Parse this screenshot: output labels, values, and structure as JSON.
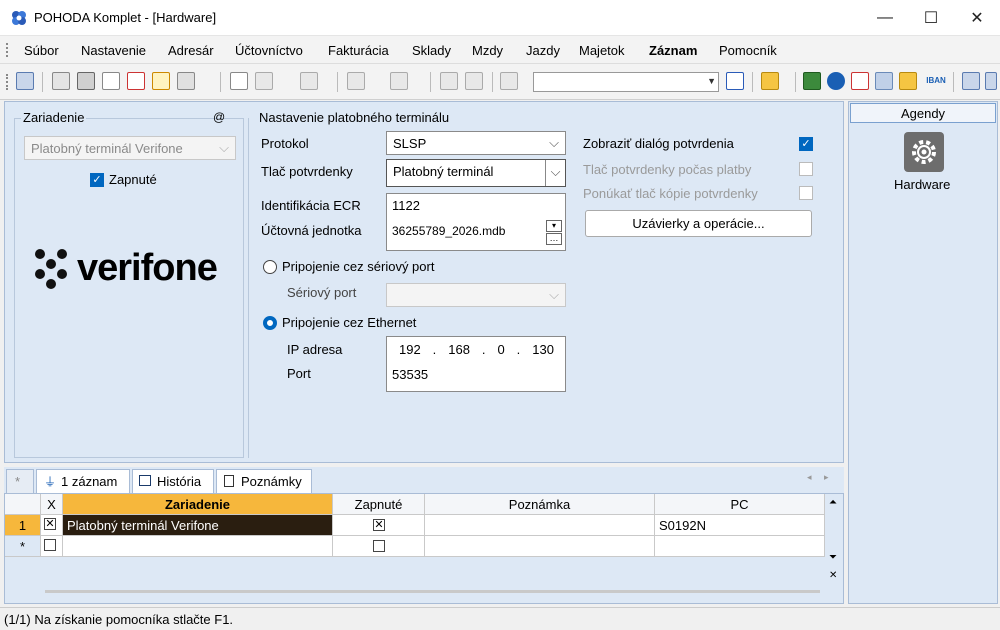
{
  "window": {
    "title": "POHODA Komplet - [Hardware]",
    "minimize": "—",
    "maximize": "☐",
    "close": "✕"
  },
  "menu": [
    {
      "label": "Súbor"
    },
    {
      "label": "Nastavenie"
    },
    {
      "label": "Adresár"
    },
    {
      "label": "Účtovníctvo"
    },
    {
      "label": "Fakturácia"
    },
    {
      "label": "Sklady"
    },
    {
      "label": "Mzdy"
    },
    {
      "label": "Jazdy"
    },
    {
      "label": "Majetok"
    },
    {
      "label": "Záznam"
    },
    {
      "label": "Pomocník"
    }
  ],
  "toolbar": {
    "combo_value": "",
    "iban_label": "IBAN"
  },
  "device_group": {
    "title": "Zariadenie",
    "at_symbol": "@",
    "device_select": "Platobný terminál Verifone",
    "enabled_label": "Zapnuté",
    "enabled": true,
    "logo_text": "verifone"
  },
  "terminal_group": {
    "title": "Nastavenie platobného terminálu",
    "protocol_label": "Protokol",
    "protocol_value": "SLSP",
    "print_label": "Tlač potvrdenky",
    "print_value": "Platobný terminál",
    "ecr_label": "Identifikácia ECR",
    "ecr_value": "1122",
    "unit_label": "Účtovná jednotka",
    "unit_value": "36255789_2026.mdb",
    "serial_radio_label": "Pripojenie cez sériový port",
    "serial_port_label": "Sériový port",
    "serial_port_value": "",
    "ethernet_radio_label": "Pripojenie cez Ethernet",
    "ip_label": "IP adresa",
    "ip_parts": [
      "192",
      "168",
      "0",
      "130"
    ],
    "port_label": "Port",
    "port_value": "53535"
  },
  "options": {
    "show_dialog_label": "Zobraziť dialóg potvrdenia",
    "print_during_label": "Tlač potvrdenky počas platby",
    "offer_copy_label": "Ponúkať tlač kópie potvrdenky",
    "closures_button": "Uzávierky a operácie..."
  },
  "agendy": {
    "header": "Agendy",
    "item_label": "Hardware"
  },
  "tabs": {
    "star": "*",
    "records": "1 záznam",
    "history": "História",
    "notes": "Poznámky"
  },
  "grid": {
    "columns": [
      "X",
      "Zariadenie",
      "Zapnuté",
      "Poznámka",
      "PC"
    ],
    "rows": [
      {
        "num": "1",
        "x": true,
        "device": "Platobný terminál Verifone",
        "enabled": true,
        "note": "",
        "pc": "S0192N"
      },
      {
        "num": "*",
        "x": false,
        "device": "",
        "enabled": false,
        "note": "",
        "pc": ""
      }
    ]
  },
  "status": {
    "text": "(1/1) Na získanie pomocníka stlačte F1."
  }
}
